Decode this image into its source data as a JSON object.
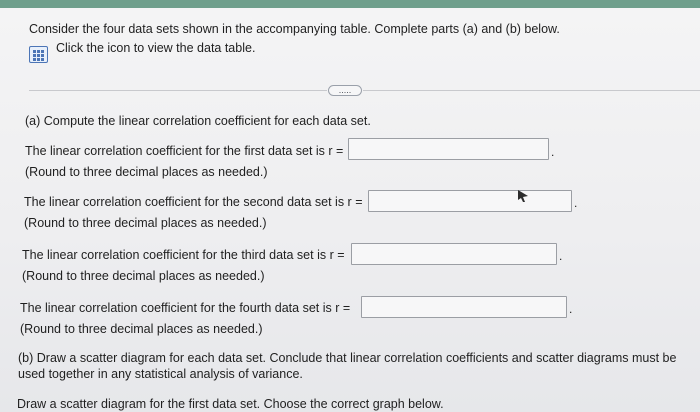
{
  "intro": {
    "prompt": "Consider the four data sets shown in the accompanying table. Complete parts (a) and (b) below.",
    "table_link": "Click the icon to view the data table.",
    "expand_button": "....."
  },
  "part_a": {
    "heading": "(a) Compute the linear correlation coefficient for each data set.",
    "questions": [
      {
        "text": "The linear correlation coefficient for the first data set is r =",
        "note": "(Round to three decimal places as needed.)",
        "value": ""
      },
      {
        "text": "The linear correlation coefficient for the second data set is r =",
        "note": "(Round to three decimal places as needed.)",
        "value": ""
      },
      {
        "text": "The linear correlation coefficient for the third data set is r =",
        "note": "(Round to three decimal places as needed.)",
        "value": ""
      },
      {
        "text": "The linear correlation coefficient for the fourth data set is r =",
        "note": "(Round to three decimal places as needed.)",
        "value": ""
      }
    ]
  },
  "part_b": {
    "heading_line1": "(b) Draw a scatter diagram for each data set. Conclude that linear correlation coefficients and scatter diagrams must be",
    "heading_line2": "used together in any statistical analysis of variance.",
    "instruction": "Draw a scatter diagram for the first data set. Choose the correct graph below."
  },
  "icons": {
    "table": "data-table-icon",
    "cursor": "mouse-pointer-icon"
  },
  "colors": {
    "accent_bar": "#6f9f8c",
    "icon_blue": "#4c75b6"
  }
}
